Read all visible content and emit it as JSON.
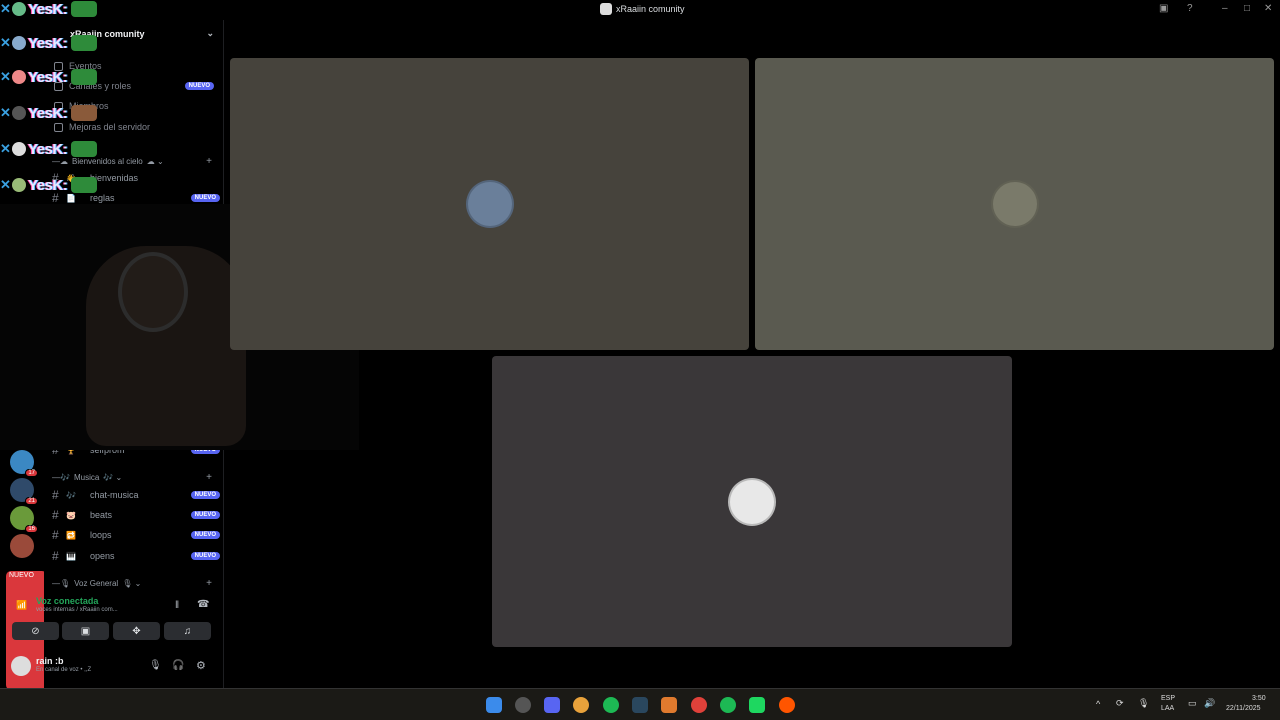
{
  "window": {
    "title": "xRaaiin comunity"
  },
  "server": {
    "name": "xRaaiin comunity",
    "menu": [
      {
        "label": "Eventos"
      },
      {
        "label": "Canales y roles",
        "badge": "NUEVO"
      },
      {
        "label": "Miembros"
      },
      {
        "label": "Mejoras del servidor"
      }
    ]
  },
  "overlay": {
    "text": "YesK:"
  },
  "categories": [
    {
      "label": "Bienvenidos al cielo"
    },
    {
      "label": "Musica"
    },
    {
      "label": "Voz General"
    }
  ],
  "channels": [
    {
      "emoji": "👋",
      "name": "bienvenidas",
      "badge": ""
    },
    {
      "emoji": "📄",
      "name": "reglas",
      "badge": "NUEVO"
    },
    {
      "emoji": "🏆",
      "name": "selfprom",
      "badge": "NUEVO"
    },
    {
      "emoji": "🎶",
      "name": "chat-musica",
      "badge": "NUEVO"
    },
    {
      "emoji": "🐷",
      "name": "beats",
      "badge": "NUEVO"
    },
    {
      "emoji": "🔁",
      "name": "loops",
      "badge": "NUEVO"
    },
    {
      "emoji": "🎹",
      "name": "opens",
      "badge": "NUEVO"
    }
  ],
  "guild_badges": [
    "3",
    "1",
    "17",
    "21",
    "16",
    "NUEVO"
  ],
  "voice": {
    "status": "Voz conectada",
    "channel": "voces internas / xRaaiin com..."
  },
  "user": {
    "name": "rain :b",
    "status": "En canal de voz • ,,Z"
  },
  "taskbar": {
    "lang_top": "ESP",
    "lang_bottom": "LAA",
    "time": "3:50",
    "date": "22/11/2025"
  },
  "colors": {
    "accent": "#5865f2",
    "connected": "#23a55a",
    "badge": "#da373c"
  }
}
